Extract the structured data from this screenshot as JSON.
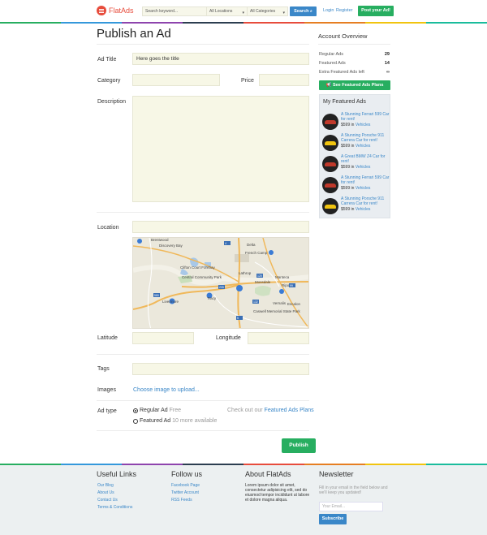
{
  "header": {
    "logo": "FlatAds",
    "search_placeholder": "Search keyword...",
    "location_select": "All Locations",
    "category_select": "All Categories",
    "search_button": "Search",
    "login": "Login",
    "register": "Register",
    "post_button": "Post your Ad!"
  },
  "stripe_colors": [
    "#27ae60",
    "#3498db",
    "#8e44ad",
    "#2c3e50",
    "#e74c3c",
    "#e67e22",
    "#f1c40f",
    "#1abc9c"
  ],
  "form": {
    "title": "Publish an Ad",
    "ad_title_label": "Ad Title",
    "ad_title_value": "Here goes the title",
    "category_label": "Category",
    "price_label": "Price",
    "description_label": "Description",
    "location_label": "Location",
    "latitude_label": "Latitude",
    "longitude_label": "Longitude",
    "tags_label": "Tags",
    "images_label": "Images",
    "images_link": "Choose image to upload...",
    "ad_type_label": "Ad type",
    "regular_ad": "Regular Ad",
    "regular_ad_note": "Free",
    "featured_ad": "Featured Ad",
    "featured_ad_note": "10 more available",
    "plans_text": "Check out our",
    "plans_link": "Featured Ads Plans",
    "publish_button": "Publish"
  },
  "map": {
    "labels": [
      "Brentwood",
      "Discovery Bay",
      "French Camp",
      "Clifton Court Forebay",
      "Central Community Park",
      "Lathrop",
      "Manteca",
      "Tracy",
      "Ripon",
      "Livermore",
      "Vernalis",
      "Caswell Memorial State Park",
      "Escalon",
      "Mossdale",
      "Delta"
    ],
    "highway_labels": [
      "4",
      "5",
      "120",
      "205",
      "580",
      "99",
      "132"
    ]
  },
  "sidebar": {
    "title": "Account Overview",
    "stats": [
      {
        "label": "Regular Ads",
        "value": "29"
      },
      {
        "label": "Featured Ads",
        "value": "14"
      },
      {
        "label": "Extra Featured Ads left",
        "value": "∞"
      }
    ],
    "plans_button": "See Featured Ads Plans",
    "featured_title": "My Featured Ads",
    "featured": [
      {
        "name": "A Stunning Ferrari 599 Car for rent!",
        "price": "$599",
        "in": "in",
        "category": "Vehicles",
        "car_color": "#c0392b"
      },
      {
        "name": "A Stunning Porsche 911 Carrera Car for rent!",
        "price": "$599",
        "in": "in",
        "category": "Vehicles",
        "car_color": "#f1c40f"
      },
      {
        "name": "A Great BMW Z4 Car for rent!",
        "price": "$599",
        "in": "in",
        "category": "Vehicles",
        "car_color": "#c0392b"
      },
      {
        "name": "A Stunning Ferrari 599 Car for rent!",
        "price": "$599",
        "in": "in",
        "category": "Vehicles",
        "car_color": "#c0392b"
      },
      {
        "name": "A Stunning Porsche 911 Carrera Car for rent!",
        "price": "$599",
        "in": "in",
        "category": "Vehicles",
        "car_color": "#f1c40f"
      }
    ]
  },
  "footer": {
    "useful_title": "Useful Links",
    "useful_links": [
      "Our Blog",
      "About Us",
      "Contact Us",
      "Terms & Conditions"
    ],
    "follow_title": "Follow us",
    "follow_links": [
      "Facebook Page",
      "Twitter Account",
      "RSS Feeds"
    ],
    "about_title": "About FlatAds",
    "about_text": [
      "Lorem ipsum dolor sit amet,",
      "consectetur adipisicing elit, sed do",
      "eiusmod tempor incididunt ut labore",
      "et dolore magna aliqua."
    ],
    "newsletter_title": "Newsletter",
    "newsletter_text": [
      "Fill in your email in the field below and",
      "we'll keep you updated!"
    ],
    "email_placeholder": "Your Email...",
    "subscribe_button": "Subscribe"
  }
}
